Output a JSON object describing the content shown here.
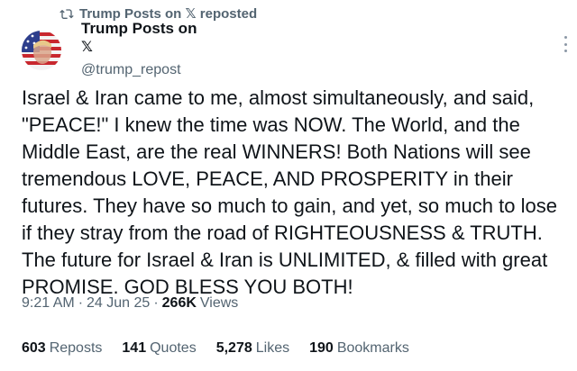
{
  "repost": {
    "text": "Trump Posts on 𝕏 reposted",
    "icon": "repost-icon"
  },
  "author": {
    "name": "Trump Posts on",
    "x_glyph": "𝕏",
    "handle": "@trump_repost",
    "avatar_icon": "flag-portrait-avatar"
  },
  "tweet": {
    "text": "Israel & Iran came to me, almost simultaneously, and said, \"PEACE!\" I knew the time was NOW. The World, and the Middle East, are the real WINNERS! Both Nations will see tremendous LOVE, PEACE, AND PROSPERITY in their futures. They have so much to gain, and yet, so much to lose if they stray from the road of RIGHTEOUSNESS & TRUTH. The future for Israel & Iran is UNLIMITED, & filled with great PROMISE. GOD BLESS YOU BOTH!",
    "time": "9:21 AM",
    "sep1": "·",
    "date": "24 Jun 25",
    "sep2": "·",
    "views": "266K",
    "views_label": "Views"
  },
  "stats": {
    "reposts": "603",
    "reposts_label": "Reposts",
    "quotes": "141",
    "quotes_label": "Quotes",
    "likes": "5,278",
    "likes_label": "Likes",
    "bookmarks": "190",
    "bookmarks_label": "Bookmarks"
  },
  "colors": {
    "text": "#0f1419",
    "secondary": "#536471"
  }
}
